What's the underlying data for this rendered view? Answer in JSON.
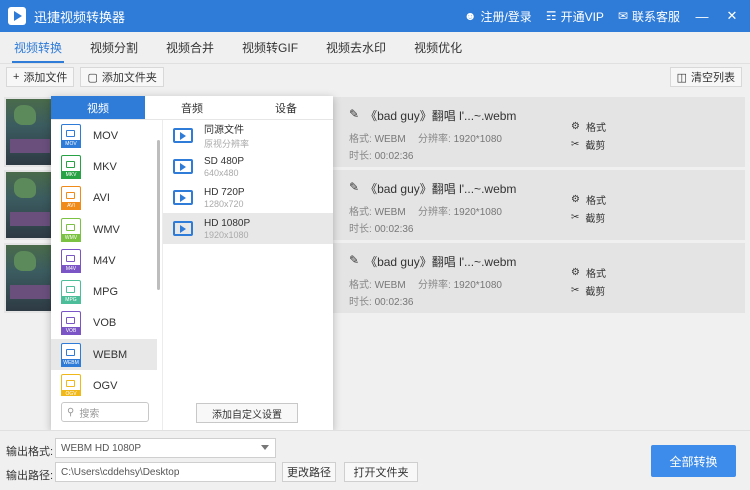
{
  "window": {
    "title": "迅捷视频转换器",
    "register_login": "注册/登录",
    "open_vip": "开通VIP",
    "contact_service": "联系客服",
    "minimize": "—",
    "close": "✕"
  },
  "tabs": [
    {
      "label": "视频转换",
      "active": true
    },
    {
      "label": "视频分割"
    },
    {
      "label": "视频合并"
    },
    {
      "label": "视频转GIF"
    },
    {
      "label": "视频去水印"
    },
    {
      "label": "视频优化"
    }
  ],
  "toolbar": {
    "add_file": "添加文件",
    "add_folder": "添加文件夹",
    "clear_list": "清空列表"
  },
  "files": [
    {
      "name": "《bad guy》翻唱 l'...~.webm",
      "format_label": "格式:",
      "format": "WEBM",
      "resolution_label": "分辨率:",
      "resolution": "1920*1080",
      "duration_label": "时长:",
      "duration": "00:02:36",
      "op_format": "格式",
      "op_cut": "截剪"
    },
    {
      "name": "《bad guy》翻唱 l'...~.webm",
      "format_label": "格式:",
      "format": "WEBM",
      "resolution_label": "分辨率:",
      "resolution": "1920*1080",
      "duration_label": "时长:",
      "duration": "00:02:36",
      "op_format": "格式",
      "op_cut": "截剪"
    },
    {
      "name": "《bad guy》翻唱 l'...~.webm",
      "format_label": "格式:",
      "format": "WEBM",
      "resolution_label": "分辨率:",
      "resolution": "1920*1080",
      "duration_label": "时长:",
      "duration": "00:02:36",
      "op_format": "格式",
      "op_cut": "截剪"
    }
  ],
  "format_panel": {
    "tabs": [
      "视频",
      "音频",
      "设备"
    ],
    "formats": [
      {
        "name": "MOV",
        "color": "#2e7bd8"
      },
      {
        "name": "MKV",
        "color": "#27a244"
      },
      {
        "name": "AVI",
        "color": "#f08a18"
      },
      {
        "name": "WMV",
        "color": "#7cc242"
      },
      {
        "name": "M4V",
        "color": "#7b55c6"
      },
      {
        "name": "MPG",
        "color": "#4cbf9a"
      },
      {
        "name": "VOB",
        "color": "#7b55c6"
      },
      {
        "name": "WEBM",
        "color": "#2e7bd8"
      },
      {
        "name": "OGV",
        "color": "#f0b818"
      }
    ],
    "selected_format": "WEBM",
    "resolutions": [
      {
        "name": "同源文件",
        "sub": "原视分辨率"
      },
      {
        "name": "SD 480P",
        "sub": "640x480"
      },
      {
        "name": "HD 720P",
        "sub": "1280x720"
      },
      {
        "name": "HD 1080P",
        "sub": "1920x1080"
      }
    ],
    "selected_resolution": "HD 1080P",
    "search_placeholder": "搜索",
    "custom_button": "添加自定义设置"
  },
  "bottom": {
    "output_format_label": "输出格式:",
    "output_format_value": "WEBM   HD 1080P",
    "output_path_label": "输出路径:",
    "output_path_value": "C:\\Users\\cddehsy\\Desktop",
    "change_path": "更改路径",
    "open_folder": "打开文件夹",
    "convert_all": "全部转换"
  }
}
